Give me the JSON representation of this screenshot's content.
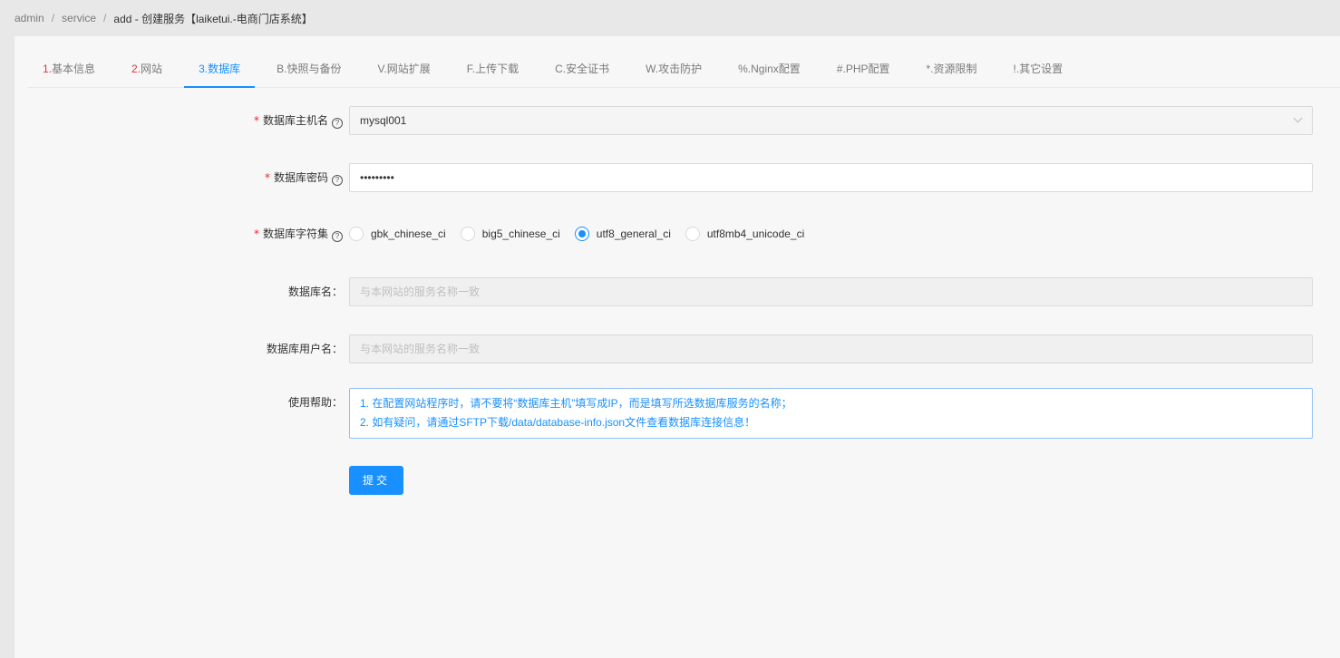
{
  "breadcrumb": {
    "items": [
      "admin",
      "service"
    ],
    "separator": "/",
    "current": "add  -  创建服务【laiketui.-电商门店系统】"
  },
  "tabs": [
    {
      "prefix": "1.",
      "label": "基本信息"
    },
    {
      "prefix": "2.",
      "label": "网站"
    },
    {
      "prefix": "3.",
      "label": "数据库"
    },
    {
      "prefix": "B.",
      "label": "快照与备份"
    },
    {
      "prefix": "V.",
      "label": "网站扩展"
    },
    {
      "prefix": "F.",
      "label": "上传下载"
    },
    {
      "prefix": "C.",
      "label": "安全证书"
    },
    {
      "prefix": "W.",
      "label": "攻击防护"
    },
    {
      "prefix": "%.",
      "label": "Nginx配置"
    },
    {
      "prefix": "#.",
      "label": "PHP配置"
    },
    {
      "prefix": "*.",
      "label": "资源限制"
    },
    {
      "prefix": "!.",
      "label": "其它设置"
    }
  ],
  "active_tab": "数据库",
  "form": {
    "db_host": {
      "label": "数据库主机名",
      "value": "mysql001"
    },
    "db_password": {
      "label": "数据库密码",
      "value": "•••••••••"
    },
    "db_charset": {
      "label": "数据库字符集",
      "options": [
        "gbk_chinese_ci",
        "big5_chinese_ci",
        "utf8_general_ci",
        "utf8mb4_unicode_ci"
      ],
      "selected": "utf8_general_ci"
    },
    "db_name": {
      "label": "数据库名：",
      "placeholder": "与本网站的服务名称一致"
    },
    "db_user": {
      "label": "数据库用户名：",
      "placeholder": "与本网站的服务名称一致"
    },
    "help": {
      "label": "使用帮助：",
      "lines": [
        "1. 在配置网站程序时，请不要将“数据库主机”填写成IP，而是填写所选数据库服务的名称；",
        "2. 如有疑问，请通过SFTP下载/data/database-info.json文件查看数据库连接信息！"
      ]
    },
    "submit_label": "提交"
  },
  "colors": {
    "accent": "#1890ff",
    "required": "#f5222d",
    "tab_prefix_red": "#d9363e"
  }
}
